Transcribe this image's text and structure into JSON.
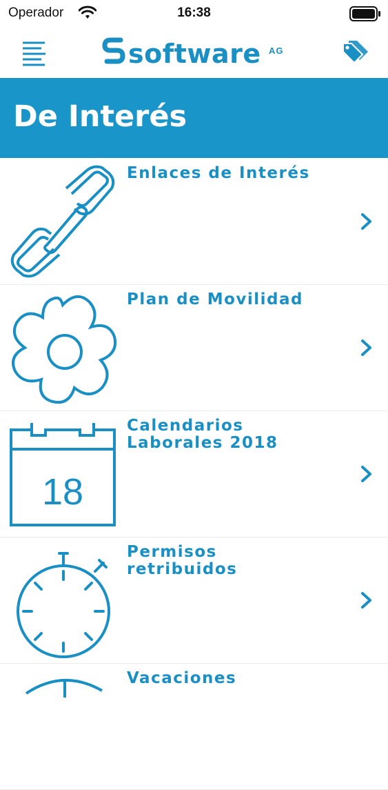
{
  "status": {
    "carrier": "Operador",
    "time": "16:38"
  },
  "brand": {
    "name": "software",
    "suffix": "AG"
  },
  "page": {
    "title": "De Interés"
  },
  "items": [
    {
      "label": "Enlaces de Interés",
      "icon": "link-icon"
    },
    {
      "label": "Plan de Movilidad",
      "icon": "flower-icon"
    },
    {
      "label": "Calendarios\nLaborales 2018",
      "icon": "calendar-icon",
      "calendar_day": "18"
    },
    {
      "label": "Permisos\nretribuidos",
      "icon": "stopwatch-icon"
    },
    {
      "label": "Vacaciones",
      "icon": "vacation-icon"
    }
  ],
  "colors": {
    "accent": "#1a95c9",
    "text_accent": "#1a8fc4"
  }
}
